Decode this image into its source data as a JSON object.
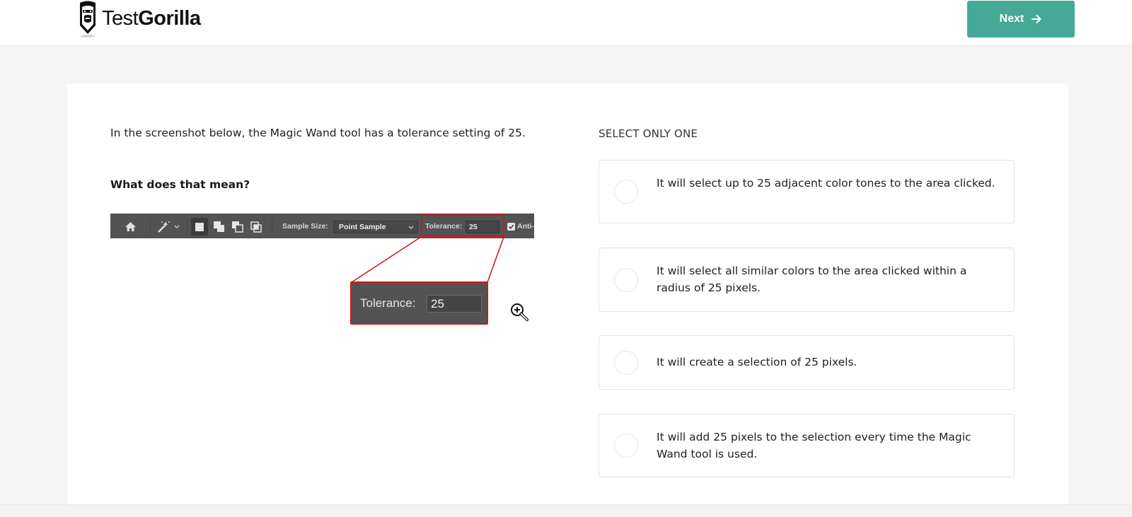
{
  "header": {
    "logo": {
      "text_light": "Test",
      "text_bold": "Gorilla",
      "icon": "gorilla-pencil-logo-icon"
    },
    "next_button": {
      "label": "Next",
      "icon": "arrow-right-icon",
      "color": "#46a997"
    }
  },
  "question": {
    "text": "In the screenshot below, the Magic Wand tool has a tolerance setting of 25.",
    "prompt": "What does that mean?",
    "image": {
      "toolbar": {
        "icons": [
          "home-icon",
          "magic-wand-icon",
          "chevron-down-icon",
          "new-selection-icon",
          "add-to-selection-icon",
          "subtract-from-selection-icon",
          "intersect-selection-icon"
        ],
        "sample_size_label": "Sample Size:",
        "sample_size_value": "Point Sample",
        "tolerance_label": "Tolerance:",
        "tolerance_value": "25",
        "anti_alias_label": "Anti-",
        "anti_alias_checked": true
      },
      "callout": {
        "label": "Tolerance:",
        "value": "25"
      },
      "zoom_icon": "zoom-in-icon",
      "highlight_color": "#d0161c"
    }
  },
  "answers": {
    "instruction": "SELECT ONLY ONE",
    "options": [
      {
        "label": "It will select up to 25 adjacent color tones to the area clicked.",
        "selected": false
      },
      {
        "label": "It will select all similar colors to the area clicked within a radius of 25 pixels.",
        "selected": false
      },
      {
        "label": "It will create a selection of 25 pixels.",
        "selected": false
      },
      {
        "label": "It will add 25 pixels to the selection every time the Magic Wand tool is used.",
        "selected": false
      }
    ]
  }
}
